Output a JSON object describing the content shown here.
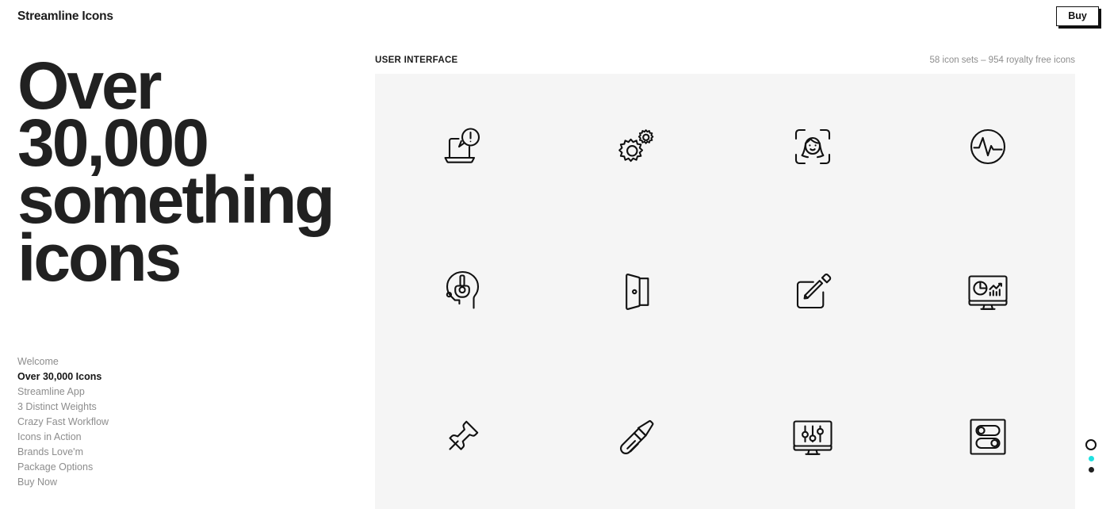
{
  "header": {
    "brand": "Streamline Icons",
    "buy_label": "Buy"
  },
  "hero": {
    "headline": "Over 30,000 something icons"
  },
  "nav": {
    "items": [
      {
        "label": "Welcome",
        "active": false
      },
      {
        "label": "Over 30,000 Icons",
        "active": true
      },
      {
        "label": "Streamline App",
        "active": false
      },
      {
        "label": "3 Distinct Weights",
        "active": false
      },
      {
        "label": "Crazy Fast Workflow",
        "active": false
      },
      {
        "label": "Icons in Action",
        "active": false
      },
      {
        "label": "Brands Love'm",
        "active": false
      },
      {
        "label": "Package Options",
        "active": false
      },
      {
        "label": "Buy Now",
        "active": false
      }
    ]
  },
  "panel": {
    "label": "USER INTERFACE",
    "meta": "58 icon sets – 954 royalty free icons",
    "background": "#f5f5f5",
    "icons": [
      {
        "name": "laptop-alert-icon"
      },
      {
        "name": "cogs-icon"
      },
      {
        "name": "face-id-icon"
      },
      {
        "name": "pulse-circle-icon"
      },
      {
        "name": "headset-support-icon"
      },
      {
        "name": "open-door-icon"
      },
      {
        "name": "edit-pencil-icon"
      },
      {
        "name": "monitor-dashboard-icon"
      },
      {
        "name": "push-pin-icon"
      },
      {
        "name": "screwdriver-icon"
      },
      {
        "name": "monitor-sliders-icon"
      },
      {
        "name": "toggle-switches-icon"
      }
    ]
  },
  "pagination": {
    "dots": [
      {
        "name": "pager-dot-1",
        "style": "ring",
        "color": "#101010"
      },
      {
        "name": "pager-dot-2",
        "style": "filled",
        "color": "#1fe0e0"
      },
      {
        "name": "pager-dot-3",
        "style": "filled",
        "color": "#202020"
      }
    ]
  }
}
